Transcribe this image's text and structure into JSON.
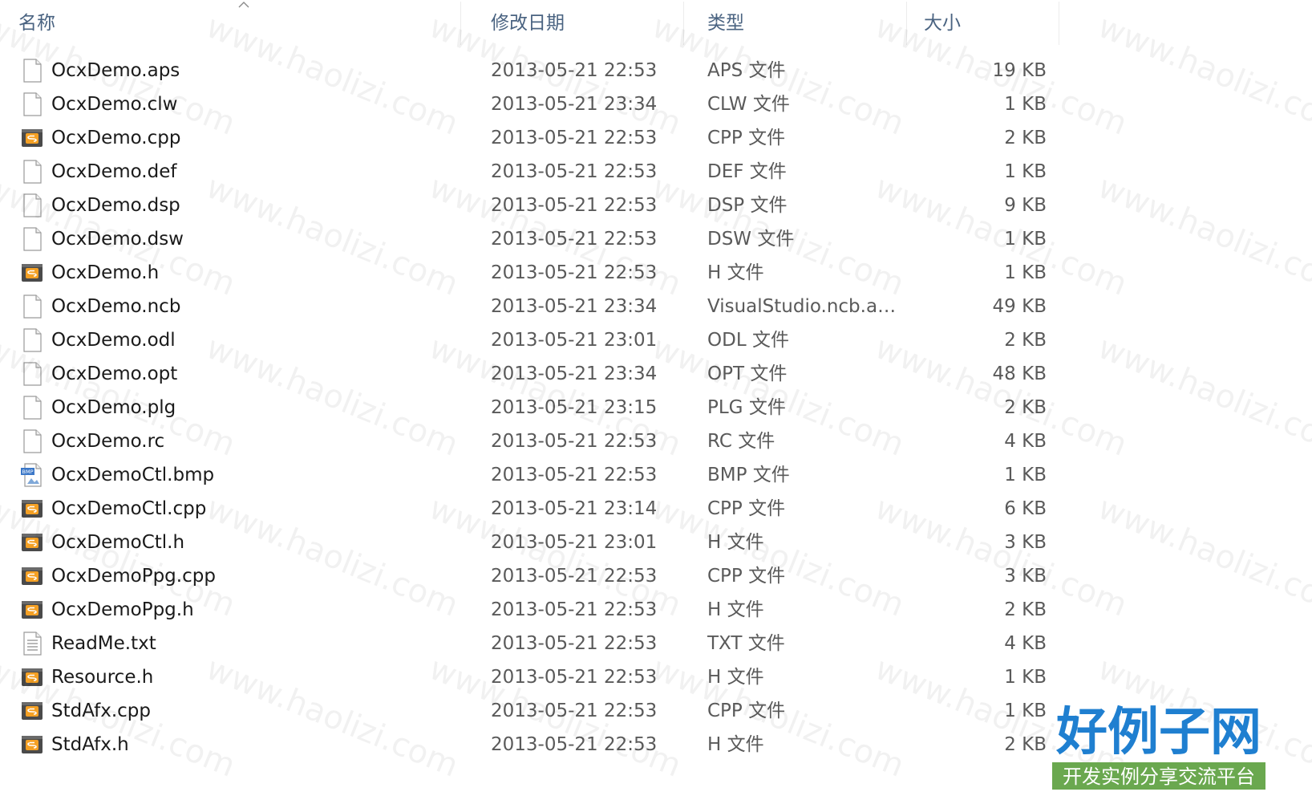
{
  "columns": {
    "name": "名称",
    "date": "修改日期",
    "type": "类型",
    "size": "大小"
  },
  "files": [
    {
      "name": "OcxDemo.aps",
      "date": "2013-05-21 22:53",
      "type": "APS 文件",
      "size": "19 KB",
      "icon": "blank-file-icon"
    },
    {
      "name": "OcxDemo.clw",
      "date": "2013-05-21 23:34",
      "type": "CLW 文件",
      "size": "1 KB",
      "icon": "blank-file-icon"
    },
    {
      "name": "OcxDemo.cpp",
      "date": "2013-05-21 22:53",
      "type": "CPP 文件",
      "size": "2 KB",
      "icon": "sublime-file-icon"
    },
    {
      "name": "OcxDemo.def",
      "date": "2013-05-21 22:53",
      "type": "DEF 文件",
      "size": "1 KB",
      "icon": "blank-file-icon"
    },
    {
      "name": "OcxDemo.dsp",
      "date": "2013-05-21 22:53",
      "type": "DSP 文件",
      "size": "9 KB",
      "icon": "blank-file-icon"
    },
    {
      "name": "OcxDemo.dsw",
      "date": "2013-05-21 22:53",
      "type": "DSW 文件",
      "size": "1 KB",
      "icon": "blank-file-icon"
    },
    {
      "name": "OcxDemo.h",
      "date": "2013-05-21 22:53",
      "type": "H 文件",
      "size": "1 KB",
      "icon": "sublime-file-icon"
    },
    {
      "name": "OcxDemo.ncb",
      "date": "2013-05-21 23:34",
      "type": "VisualStudio.ncb.a0...",
      "size": "49 KB",
      "icon": "blank-file-icon"
    },
    {
      "name": "OcxDemo.odl",
      "date": "2013-05-21 23:01",
      "type": "ODL 文件",
      "size": "2 KB",
      "icon": "blank-file-icon"
    },
    {
      "name": "OcxDemo.opt",
      "date": "2013-05-21 23:34",
      "type": "OPT 文件",
      "size": "48 KB",
      "icon": "blank-file-icon"
    },
    {
      "name": "OcxDemo.plg",
      "date": "2013-05-21 23:15",
      "type": "PLG 文件",
      "size": "2 KB",
      "icon": "blank-file-icon"
    },
    {
      "name": "OcxDemo.rc",
      "date": "2013-05-21 22:53",
      "type": "RC 文件",
      "size": "4 KB",
      "icon": "blank-file-icon"
    },
    {
      "name": "OcxDemoCtl.bmp",
      "date": "2013-05-21 22:53",
      "type": "BMP 文件",
      "size": "1 KB",
      "icon": "bmp-file-icon"
    },
    {
      "name": "OcxDemoCtl.cpp",
      "date": "2013-05-21 23:14",
      "type": "CPP 文件",
      "size": "6 KB",
      "icon": "sublime-file-icon"
    },
    {
      "name": "OcxDemoCtl.h",
      "date": "2013-05-21 23:01",
      "type": "H 文件",
      "size": "3 KB",
      "icon": "sublime-file-icon"
    },
    {
      "name": "OcxDemoPpg.cpp",
      "date": "2013-05-21 22:53",
      "type": "CPP 文件",
      "size": "3 KB",
      "icon": "sublime-file-icon"
    },
    {
      "name": "OcxDemoPpg.h",
      "date": "2013-05-21 22:53",
      "type": "H 文件",
      "size": "2 KB",
      "icon": "sublime-file-icon"
    },
    {
      "name": "ReadMe.txt",
      "date": "2013-05-21 22:53",
      "type": "TXT 文件",
      "size": "4 KB",
      "icon": "text-file-icon"
    },
    {
      "name": "Resource.h",
      "date": "2013-05-21 22:53",
      "type": "H 文件",
      "size": "1 KB",
      "icon": "sublime-file-icon"
    },
    {
      "name": "StdAfx.cpp",
      "date": "2013-05-21 22:53",
      "type": "CPP 文件",
      "size": "1 KB",
      "icon": "sublime-file-icon"
    },
    {
      "name": "StdAfx.h",
      "date": "2013-05-21 22:53",
      "type": "H 文件",
      "size": "2 KB",
      "icon": "sublime-file-icon"
    }
  ],
  "watermark": {
    "text": "www.haolizi.com",
    "logo_title": "好例子网",
    "logo_subtitle": "开发实例分享交流平台"
  },
  "colors": {
    "header_text": "#4a6381",
    "logo_blue": "#1f7fd0",
    "logo_green": "#6aa84f"
  }
}
